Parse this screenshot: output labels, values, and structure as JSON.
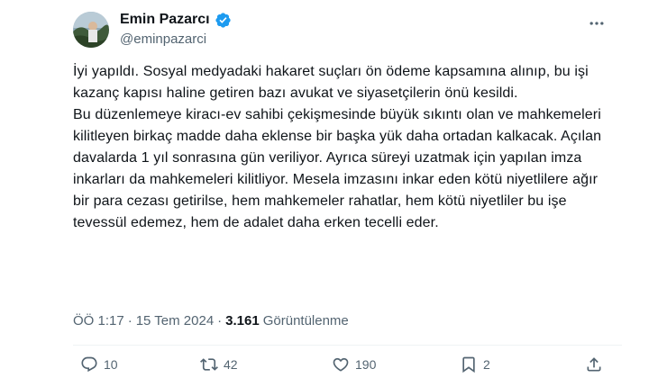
{
  "author": {
    "name": "Emin Pazarcı",
    "handle": "@eminpazarci"
  },
  "tweet": {
    "paragraphs": [
      "İyi yapıldı. Sosyal medyadaki hakaret suçları ön ödeme kapsamına alınıp, bu işi kazanç kapısı haline getiren bazı avukat ve siyasetçilerin önü kesildi.",
      "Bu düzenlemeye kiracı-ev sahibi çekişmesinde büyük sıkıntı olan ve mahkemeleri kilitleyen birkaç madde  daha eklense bir başka yük daha ortadan kalkacak.  Açılan davalarda 1 yıl sonrasına gün veriliyor. Ayrıca süreyi uzatmak için yapılan imza inkarları da mahkemeleri kilitliyor. Mesela imzasını inkar eden kötü niyetlilere ağır bir para cezası getirilse, hem mahkemeler rahatlar, hem kötü niyetliler bu işe tevessül edemez, hem de adalet daha erken tecelli eder."
    ]
  },
  "meta": {
    "time": "ÖÖ 1:17",
    "separator": "·",
    "date": "15 Tem 2024",
    "views_count": "3.161",
    "views_label": "Görüntülenme"
  },
  "actions": {
    "replies": "10",
    "reposts": "42",
    "likes": "190",
    "bookmarks": "2"
  },
  "colors": {
    "text": "#0f1419",
    "secondary": "#536471",
    "verified": "#1d9bf0",
    "divider": "#eff3f4"
  },
  "icons": [
    "more-icon",
    "verified-badge-icon",
    "reply-icon",
    "repost-icon",
    "like-icon",
    "bookmark-icon",
    "share-icon"
  ]
}
